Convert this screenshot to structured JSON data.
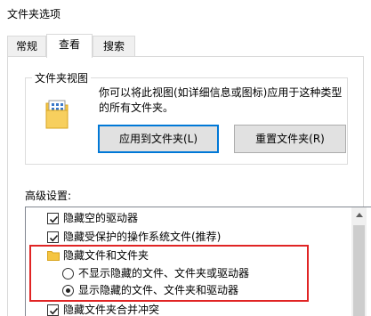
{
  "window": {
    "title": "文件夹选项"
  },
  "tabs": [
    {
      "label": "常规",
      "active": false
    },
    {
      "label": "查看",
      "active": true
    },
    {
      "label": "搜索",
      "active": false
    }
  ],
  "folder_views": {
    "group_title": "文件夹视图",
    "description": "你可以将此视图(如详细信息或图标)应用于这种类型的所有文件夹。",
    "apply_button": "应用到文件夹(L)",
    "reset_button": "重置文件夹(R)"
  },
  "advanced": {
    "label": "高级设置:",
    "items": [
      {
        "type": "checkbox",
        "checked": true,
        "label": "隐藏空的驱动器"
      },
      {
        "type": "checkbox",
        "checked": true,
        "label": "隐藏受保护的操作系统文件(推荐)"
      },
      {
        "type": "folder",
        "label": "隐藏文件和文件夹"
      },
      {
        "type": "radio",
        "selected": false,
        "label": "不显示隐藏的文件、文件夹或驱动器"
      },
      {
        "type": "radio",
        "selected": true,
        "label": "显示隐藏的文件、文件夹和驱动器"
      },
      {
        "type": "checkbox",
        "checked": true,
        "label": "隐藏文件夹合并冲突"
      }
    ]
  },
  "colors": {
    "highlight_border": "#e02424",
    "focus_border": "#0078d7",
    "folder_yellow": "#f5c542"
  }
}
